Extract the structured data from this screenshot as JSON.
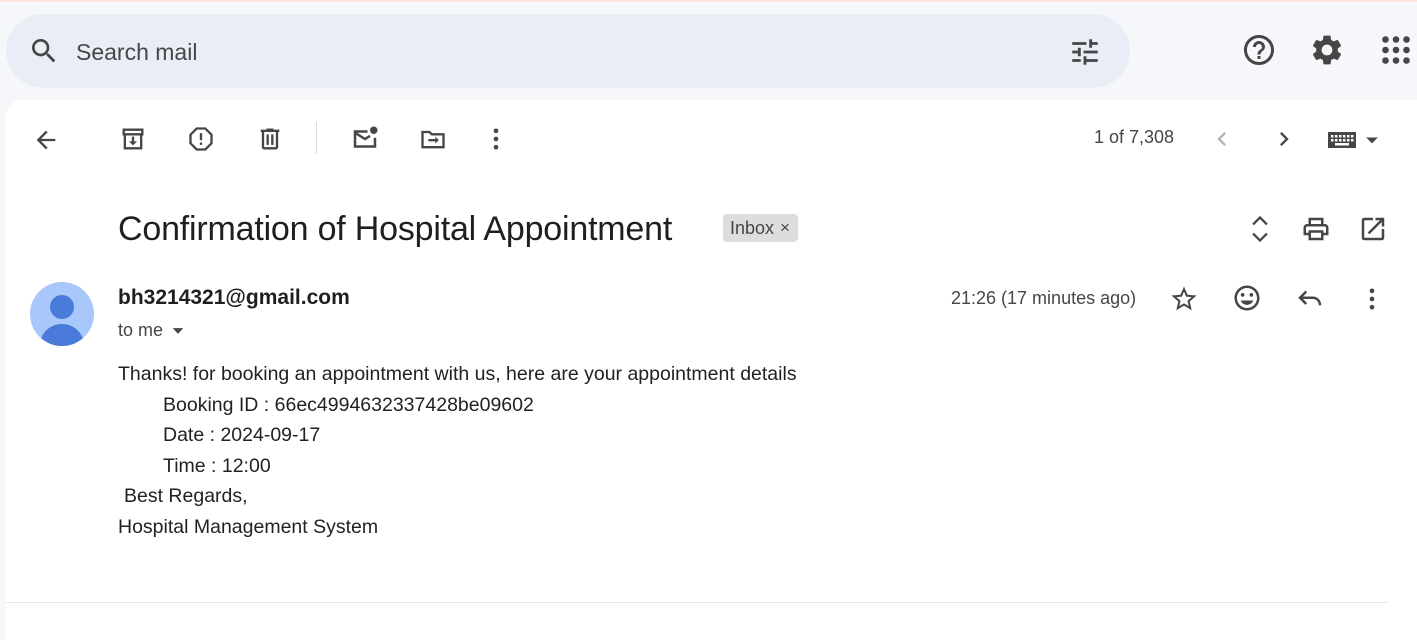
{
  "search": {
    "placeholder": "Search mail"
  },
  "header": {
    "icons": [
      "search-icon",
      "tune-icon",
      "help-icon",
      "settings-icon",
      "apps-icon"
    ]
  },
  "toolbar": {
    "count": "1 of 7,308",
    "icons": [
      "back-arrow-icon",
      "archive-icon",
      "report-spam-icon",
      "delete-icon",
      "mark-unread-icon",
      "move-to-icon",
      "more-vert-icon",
      "chevron-left-icon",
      "chevron-right-icon",
      "keyboard-icon",
      "dropdown-icon"
    ]
  },
  "message": {
    "subject": "Confirmation of Hospital Appointment",
    "label": "Inbox",
    "label_close": "×",
    "sender": "bh3214321@gmail.com",
    "recipient": "to me",
    "time": "21:26 (17 minutes ago)",
    "body": {
      "intro": "Thanks! for booking an appointment with us, here are your appointment details",
      "booking_id": "Booking ID : 66ec4994632337428be09602",
      "date": "Date : 2024-09-17",
      "time": "Time : 12:00",
      "regards": "Best Regards,",
      "signature": "Hospital Management System"
    }
  },
  "colors": {
    "accent": "#0b57d0",
    "avatar_bg": "#a8c7fa",
    "avatar_fg": "#4a7ad9",
    "search_bg": "#e9eef6"
  }
}
